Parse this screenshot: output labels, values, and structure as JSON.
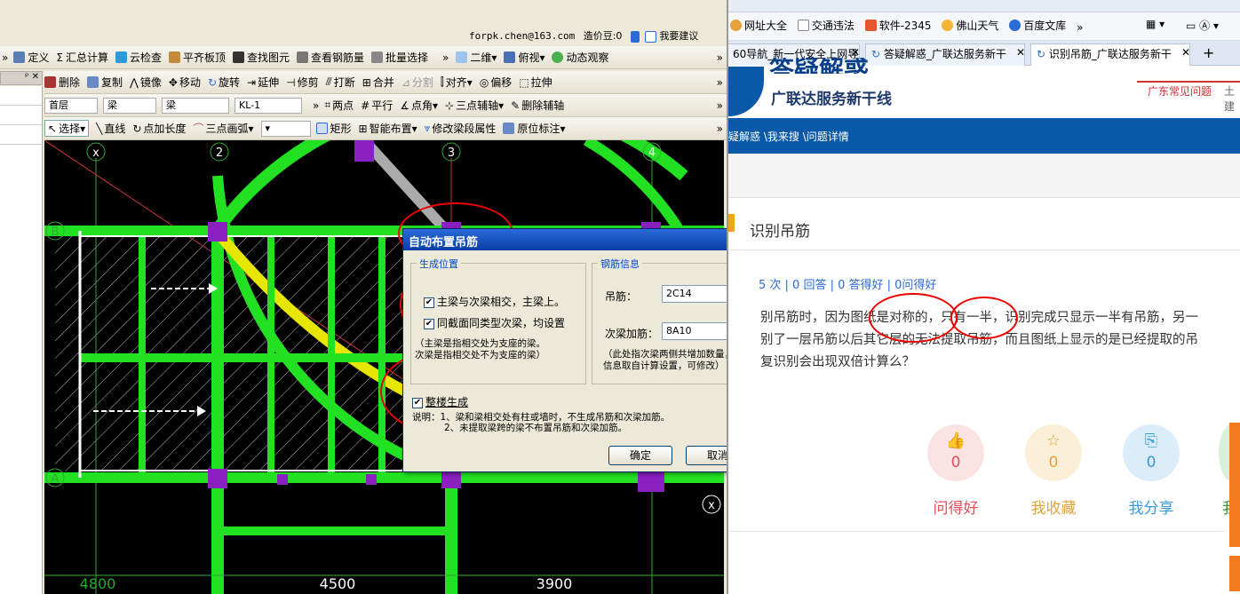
{
  "cad": {
    "top_bar": {
      "account": "forpk.chen@163.com",
      "price_label": "造价豆:0",
      "help_label": "我要建议"
    },
    "toolbar1": {
      "items": [
        "定义",
        "汇总计算",
        "云检查",
        "平齐板顶",
        "查找图元",
        "查看钢筋量",
        "批量选择"
      ],
      "view_mode": "二维",
      "view_dir": "俯视",
      "dynamic": "动态观察"
    },
    "toolbar2": {
      "items": [
        "删除",
        "复制",
        "镜像",
        "移动",
        "旋转",
        "延伸",
        "修剪",
        "打断",
        "合并",
        "分割",
        "对齐",
        "偏移",
        "拉伸"
      ]
    },
    "toolbar3": {
      "floor": "首层",
      "type1": "梁",
      "type2": "梁",
      "name": "KL-1",
      "items": [
        "两点",
        "平行",
        "点角",
        "三点辅轴",
        "删除辅轴"
      ]
    },
    "toolbar4": {
      "items": [
        "选择",
        "直线",
        "点加长度",
        "三点画弧",
        "矩形",
        "智能布置",
        "修改梁段属性",
        "原位标注"
      ]
    },
    "axes": {
      "top": [
        "x",
        "2",
        "3",
        "4"
      ],
      "left": [
        "B",
        "A"
      ],
      "right_x": "x",
      "dims": [
        "4500",
        "3900"
      ],
      "bottom_left": "4800"
    },
    "dialog": {
      "title": "自动布置吊筋",
      "close": "X",
      "left_group": "生成位置",
      "opt1": "主梁与次梁相交，主梁上。",
      "opt2": "同截面同类型次梁，均设置",
      "note1": "（主梁是指相交处为支座的梁。",
      "note2": "次梁是指相交处不为支座的梁）",
      "right_group": "钢筋信息",
      "hanger_label": "吊筋：",
      "hanger_value": "2C14",
      "stirrup_label": "次梁加筋：",
      "stirrup_value": "8A10",
      "info1": "（此处指次梁两侧共增加数量，",
      "info2": "信息取自计算设置，可修改）",
      "whole": "整楼生成",
      "desc1": "说明：1、梁和梁相交处有柱或墙时，不生成吊筋和次梁加筋。",
      "desc2": "2、未提取梁跨的梁不布置吊筋和次梁加筋。",
      "ok": "确定",
      "cancel": "取消"
    }
  },
  "browser": {
    "bookmarks": [
      "网址大全",
      "交通违法",
      "软件-2345",
      "佛山天气",
      "百度文库"
    ],
    "tabs": [
      "60导航_新一代安全上网导",
      "答疑解惑_广联达服务新干",
      "识别吊筋_广联达服务新干"
    ],
    "logo_title": "答疑解惑",
    "logo_sub": "广联达服务新干线",
    "header_link1": "广东常见问题",
    "header_link2": "土建",
    "breadcrumb": "疑解惑 \\我来搜 \\问题详情",
    "question_title": "识别吊筋",
    "stats_line": "5 次 | 0 回答 | 0 答得好 | 0问得好",
    "body1": "别吊筋时，因为图纸是对称的，只有一半，识别完成只显示一半有吊筋，另一",
    "body2": "别了一层吊筋以后其它层的无法提取吊筋，而且图纸上显示的是已经提取的吊",
    "body3": "复识别会出现双倍计算么？",
    "actions": [
      {
        "label": "问得好",
        "count": "0",
        "color": "#e5505a"
      },
      {
        "label": "我收藏",
        "count": "0",
        "color": "#e0a43a"
      },
      {
        "label": "我分享",
        "count": "0",
        "color": "#3a9ad9"
      }
    ],
    "side_label": "我"
  }
}
